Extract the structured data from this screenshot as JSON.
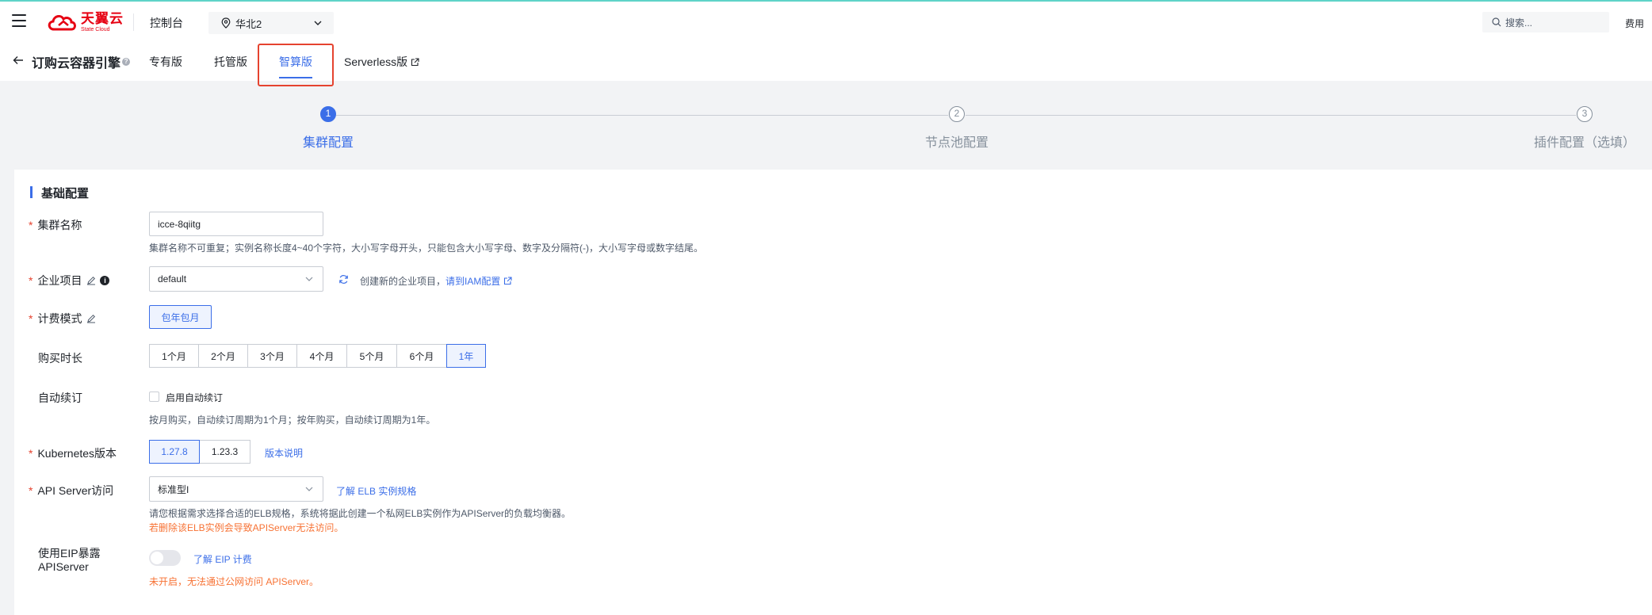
{
  "topbar": {
    "logo_cn": "天翼云",
    "logo_en": "State Cloud",
    "console": "控制台",
    "region": "华北2",
    "search_placeholder": "搜索...",
    "fee": "费用"
  },
  "subheader": {
    "title": "订购云容器引擎",
    "tabs": [
      {
        "label": "专有版"
      },
      {
        "label": "托管版"
      },
      {
        "label": "智算版"
      },
      {
        "label": "Serverless版"
      }
    ]
  },
  "steps": [
    {
      "number": "1",
      "label": "集群配置"
    },
    {
      "number": "2",
      "label": "节点池配置"
    },
    {
      "number": "3",
      "label": "插件配置（选填）"
    }
  ],
  "form": {
    "section_title": "基础配置",
    "cluster_name": {
      "label": "集群名称",
      "value": "icce-8qiitg",
      "hint": "集群名称不可重复；实例名称长度4~40个字符，大小写字母开头，只能包含大小写字母、数字及分隔符(-)，大小写字母或数字结尾。"
    },
    "enterprise_project": {
      "label": "企业项目",
      "value": "default",
      "create_hint": "创建新的企业项目，",
      "iam_link": "请到IAM配置"
    },
    "billing_mode": {
      "label": "计费模式",
      "option": "包年包月"
    },
    "duration": {
      "label": "购买时长",
      "options": [
        "1个月",
        "2个月",
        "3个月",
        "4个月",
        "5个月",
        "6个月",
        "1年"
      ],
      "selected": "1年"
    },
    "auto_renew": {
      "label": "自动续订",
      "checkbox_label": "启用自动续订",
      "checked": false,
      "hint": "按月购买，自动续订周期为1个月；按年购买，自动续订周期为1年。"
    },
    "k8s_version": {
      "label": "Kubernetes版本",
      "options": [
        "1.27.8",
        "1.23.3"
      ],
      "selected": "1.27.8",
      "link": "版本说明"
    },
    "api_server": {
      "label": "API Server访问",
      "value": "标准型I",
      "link": "了解 ELB 实例规格",
      "hint": "请您根据需求选择合适的ELB规格，系统将据此创建一个私网ELB实例作为APIServer的负载均衡器。",
      "warning": "若删除该ELB实例会导致APIServer无法访问。"
    },
    "eip": {
      "label_line1": "使用EIP暴露",
      "label_line2": "APIServer",
      "enabled": false,
      "link": "了解 EIP 计费",
      "warning": "未开启，无法通过公网访问 APIServer。"
    }
  },
  "colors": {
    "accent": "#3b6ee8",
    "required": "#e5432f",
    "warning": "#f77234",
    "brand": "#e60012"
  }
}
